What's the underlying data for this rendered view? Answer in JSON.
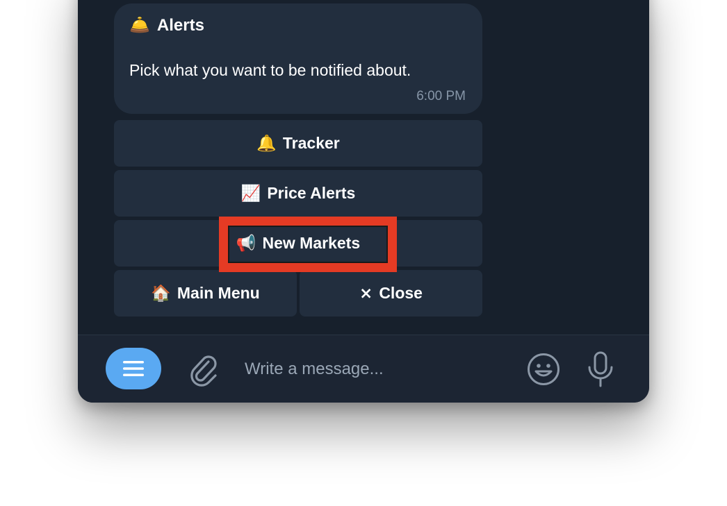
{
  "message": {
    "title_emoji": "🛎️",
    "title": "Alerts",
    "body": "Pick what you want to be notified about.",
    "time": "6:00 PM"
  },
  "keyboard": {
    "tracker": {
      "emoji": "🔔",
      "label": "Tracker"
    },
    "price_alerts": {
      "emoji": "📈",
      "label": "Price Alerts"
    },
    "new_markets": {
      "emoji": "📢",
      "label": "New Markets"
    },
    "main_menu": {
      "emoji": "🏠",
      "label": "Main Menu"
    },
    "close": {
      "emoji": "×",
      "label": "Close"
    }
  },
  "composer": {
    "placeholder": "Write a message..."
  },
  "colors": {
    "background": "#17202c",
    "bubble": "#222e3e",
    "accent": "#5aa9f2",
    "highlight": "#e53b24"
  },
  "icons": [
    "menu-icon",
    "paperclip-icon",
    "smile-icon",
    "microphone-icon"
  ]
}
